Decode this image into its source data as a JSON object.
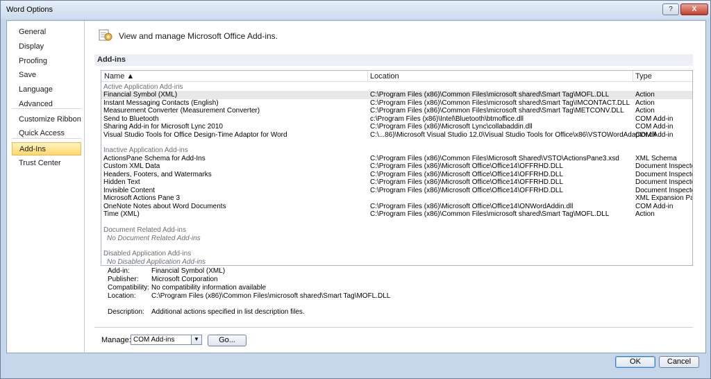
{
  "window": {
    "title": "Word Options",
    "help_label": "?",
    "close_label": "X"
  },
  "nav": {
    "items": [
      {
        "label": "General"
      },
      {
        "label": "Display"
      },
      {
        "label": "Proofing"
      },
      {
        "label": "Save"
      },
      {
        "label": "Language"
      },
      {
        "label": "Advanced"
      },
      {
        "label": "Customize Ribbon"
      },
      {
        "label": "Quick Access Toolbar"
      },
      {
        "label": "Add-Ins"
      },
      {
        "label": "Trust Center"
      }
    ],
    "selected": "Add-Ins"
  },
  "header": {
    "text": "View and manage Microsoft Office Add-ins.",
    "icon": "addins-gear-icon"
  },
  "section": {
    "title": "Add-ins"
  },
  "table": {
    "headers": {
      "name": "Name ▲",
      "location": "Location",
      "type": "Type"
    },
    "groups": {
      "active": "Active Application Add-ins",
      "inactive": "Inactive Application Add-ins",
      "document": "Document Related Add-ins",
      "document_empty": "No Document Related Add-ins",
      "disabled": "Disabled Application Add-ins",
      "disabled_empty": "No Disabled Application Add-ins"
    },
    "active_rows": [
      {
        "name": "Financial Symbol (XML)",
        "location": "C:\\Program Files (x86)\\Common Files\\microsoft shared\\Smart Tag\\MOFL.DLL",
        "type": "Action"
      },
      {
        "name": "Instant Messaging Contacts (English)",
        "location": "C:\\Program Files (x86)\\Common Files\\microsoft shared\\Smart Tag\\IMCONTACT.DLL",
        "type": "Action"
      },
      {
        "name": "Measurement Converter (Measurement Converter)",
        "location": "C:\\Program Files (x86)\\Common Files\\microsoft shared\\Smart Tag\\METCONV.DLL",
        "type": "Action"
      },
      {
        "name": "Send to Bluetooth",
        "location": "c:\\Program Files (x86)\\Intel\\Bluetooth\\btmoffice.dll",
        "type": "COM Add-in"
      },
      {
        "name": "Sharing Add-in for Microsoft Lync 2010",
        "location": "C:\\Program Files (x86)\\Microsoft Lync\\collabaddin.dll",
        "type": "COM Add-in"
      },
      {
        "name": "Visual Studio Tools for Office Design-Time Adaptor for Word",
        "location": "C:\\...86)\\Microsoft Visual Studio 12.0\\Visual Studio Tools for Office\\x86\\VSTOWordAdaptor.dll",
        "type": "COM Add-in"
      }
    ],
    "inactive_rows": [
      {
        "name": "ActionsPane Schema for Add-Ins",
        "location": "C:\\Program Files (x86)\\Common Files\\Microsoft Shared\\VSTO\\ActionsPane3.xsd",
        "type": "XML Schema"
      },
      {
        "name": "Custom XML Data",
        "location": "C:\\Program Files (x86)\\Microsoft Office\\Office14\\OFFRHD.DLL",
        "type": "Document Inspector"
      },
      {
        "name": "Headers, Footers, and Watermarks",
        "location": "C:\\Program Files (x86)\\Microsoft Office\\Office14\\OFFRHD.DLL",
        "type": "Document Inspector"
      },
      {
        "name": "Hidden Text",
        "location": "C:\\Program Files (x86)\\Microsoft Office\\Office14\\OFFRHD.DLL",
        "type": "Document Inspector"
      },
      {
        "name": "Invisible Content",
        "location": "C:\\Program Files (x86)\\Microsoft Office\\Office14\\OFFRHD.DLL",
        "type": "Document Inspector"
      },
      {
        "name": "Microsoft Actions Pane 3",
        "location": "",
        "type": "XML Expansion Pack"
      },
      {
        "name": "OneNote Notes about Word Documents",
        "location": "C:\\Program Files (x86)\\Microsoft Office\\Office14\\ONWordAddin.dll",
        "type": "COM Add-in"
      },
      {
        "name": "Time (XML)",
        "location": "C:\\Program Files (x86)\\Common Files\\microsoft shared\\Smart Tag\\MOFL.DLL",
        "type": "Action"
      }
    ]
  },
  "details": {
    "addin_label": "Add-in:",
    "addin_value": "Financial Symbol (XML)",
    "publisher_label": "Publisher:",
    "publisher_value": "Microsoft Corporation",
    "compat_label": "Compatibility:",
    "compat_value": "No compatibility information available",
    "location_label": "Location:",
    "location_value": "C:\\Program Files (x86)\\Common Files\\microsoft shared\\Smart Tag\\MOFL.DLL",
    "desc_label": "Description:",
    "desc_value": "Additional actions specified in list description files."
  },
  "manage": {
    "label": "Manage:",
    "selected": "COM Add-ins",
    "go_label": "Go..."
  },
  "footer": {
    "ok_label": "OK",
    "cancel_label": "Cancel"
  }
}
